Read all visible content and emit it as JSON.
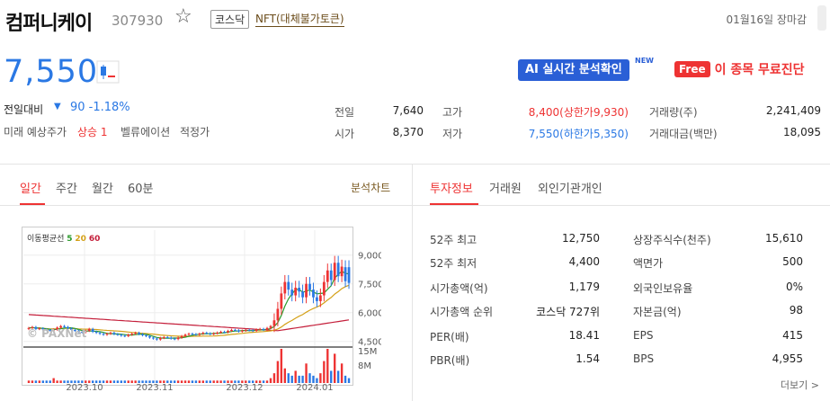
{
  "header": {
    "name": "컴퍼니케이",
    "code": "307930",
    "market": "코스닥",
    "theme": "NFT(대체불가토큰)",
    "closed_status": "01월16일 장마감"
  },
  "price": {
    "current": "7,550",
    "change_label": "전일대비",
    "change_arrow": "▼",
    "change_value": "90 -1.18%",
    "prediction_label": "미래 예상주가",
    "prediction_value": "상승 1",
    "valuation_label": "벨류에이션",
    "valuation_value": "적정가"
  },
  "promo": {
    "ai_label": "AI 실시간 분석확인",
    "ai_new": "NEW",
    "free_badge": "Free",
    "free_text": "이 종목 무료진단"
  },
  "quote": {
    "prev_label": "전일",
    "prev_value": "7,640",
    "open_label": "시가",
    "open_value": "8,370",
    "high_label": "고가",
    "high_value": "8,400(상한가9,930)",
    "low_label": "저가",
    "low_value": "7,550(하한가5,350)",
    "volume_label": "거래량(주)",
    "volume_value": "2,241,409",
    "amount_label": "거래대금(백만)",
    "amount_value": "18,095"
  },
  "chart_tabs": [
    "일간",
    "주간",
    "월간",
    "60분"
  ],
  "analysis_link": "분석차트",
  "info_tabs": [
    "투자정보",
    "거래원",
    "외인기관개인"
  ],
  "chart_data": {
    "type": "candlestick",
    "ma_legend_title": "이동평균선",
    "ma_labels": [
      "5",
      "20",
      "60"
    ],
    "ma_colors": {
      "ma5": "#2a9a2a",
      "ma20": "#d4a017",
      "ma60": "#c41e3a"
    },
    "y_ticks": [
      "9,000",
      "7,500",
      "6,000",
      "4,500"
    ],
    "y_range": [
      4300,
      10300
    ],
    "volume_ticks": [
      "15M",
      "8M"
    ],
    "x_ticks": [
      "2023.10",
      "2023.11",
      "2023.12",
      "2024.01"
    ],
    "watermark": "© PAXNet",
    "closes": [
      5200,
      5250,
      5150,
      5180,
      5120,
      5100,
      5080,
      5120,
      5220,
      5300,
      5250,
      5180,
      5100,
      5060,
      5000,
      4980,
      5050,
      5150,
      5000,
      4950,
      4900,
      4850,
      4900,
      4950,
      4880,
      4850,
      4800,
      4780,
      4850,
      4900,
      4950,
      4880,
      4820,
      4780,
      4700,
      4650,
      4600,
      4680,
      4720,
      4700,
      4650,
      4620,
      4700,
      4780,
      4850,
      4900,
      4880,
      4850,
      4900,
      4950,
      4920,
      4880,
      4920,
      4960,
      5000,
      4980,
      5050,
      5100,
      5080,
      5020,
      5060,
      5100,
      5080,
      5050,
      5120,
      5150,
      5100,
      5200,
      5300,
      5600,
      6200,
      7000,
      7600,
      7200,
      6900,
      7300,
      7100,
      6800,
      7500,
      7200,
      6800,
      6600,
      6900,
      7600,
      8200,
      7700,
      8600,
      7900,
      8400,
      7640,
      7550
    ],
    "opens": [
      5150,
      5200,
      5250,
      5150,
      5180,
      5120,
      5100,
      5080,
      5120,
      5220,
      5300,
      5250,
      5180,
      5100,
      5060,
      5000,
      4980,
      5050,
      5150,
      5000,
      4950,
      4900,
      4850,
      4900,
      4950,
      4880,
      4850,
      4800,
      4780,
      4850,
      4900,
      4950,
      4880,
      4820,
      4780,
      4700,
      4650,
      4600,
      4680,
      4720,
      4700,
      4650,
      4620,
      4700,
      4780,
      4850,
      4900,
      4880,
      4850,
      4900,
      4950,
      4920,
      4880,
      4920,
      4960,
      5000,
      4980,
      5050,
      5100,
      5080,
      5020,
      5060,
      5100,
      5080,
      5050,
      5120,
      5150,
      5100,
      5200,
      5300,
      5600,
      6200,
      7000,
      7600,
      7200,
      6900,
      7300,
      7100,
      6800,
      7500,
      7200,
      6800,
      6600,
      6900,
      7600,
      8200,
      7700,
      8600,
      7900,
      8370,
      8370
    ],
    "volumes": [
      1,
      1,
      1,
      1,
      1,
      1,
      1,
      2,
      1,
      1,
      1,
      1,
      1,
      1,
      1,
      1,
      1,
      1,
      1,
      1,
      1,
      1,
      1,
      1,
      1,
      1,
      1,
      1,
      1,
      1,
      1,
      1,
      1,
      1,
      1,
      1,
      1,
      1,
      1,
      1,
      1,
      1,
      1,
      1,
      1,
      1,
      1,
      1,
      1,
      1,
      1,
      1,
      1,
      1,
      1,
      1,
      1,
      1,
      1,
      1,
      1,
      1,
      1,
      1,
      1,
      1,
      1,
      1,
      2,
      4,
      9,
      14,
      6,
      4,
      3,
      5,
      3,
      3,
      8,
      4,
      3,
      2,
      4,
      9,
      14,
      5,
      12,
      5,
      8,
      3,
      2
    ]
  },
  "invest": {
    "left": [
      {
        "label": "52주 최고",
        "value": "12,750"
      },
      {
        "label": "52주 최저",
        "value": "4,400"
      },
      {
        "label": "시가총액(억)",
        "value": "1,179"
      },
      {
        "label": "시가총액 순위",
        "value": "코스닥 727위"
      },
      {
        "label": "PER(배)",
        "value": "18.41"
      },
      {
        "label": "PBR(배)",
        "value": "1.54"
      }
    ],
    "right": [
      {
        "label": "상장주식수(천주)",
        "value": "15,610"
      },
      {
        "label": "액면가",
        "value": "500"
      },
      {
        "label": "외국인보유율",
        "value": "0%"
      },
      {
        "label": "자본금(억)",
        "value": "98"
      },
      {
        "label": "EPS",
        "value": "415"
      },
      {
        "label": "BPS",
        "value": "4,955"
      }
    ],
    "more": "더보기 >"
  }
}
